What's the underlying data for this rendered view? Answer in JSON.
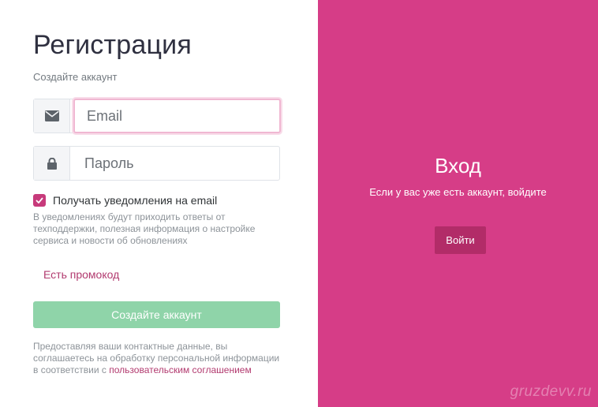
{
  "register": {
    "title": "Регистрация",
    "subtitle": "Создайте аккаунт",
    "email_placeholder": "Email",
    "password_placeholder": "Пароль",
    "notify_label": "Получать уведомления на email",
    "notify_checked": true,
    "notify_hint": "В уведомлениях будут приходить ответы от техподдержки, полезная информация о настройке сервиса и новости об обновлениях",
    "promo_link": "Есть промокод",
    "create_button": "Создайте аккаунт",
    "legal_text": "Предоставляя ваши контактные данные, вы соглашаетесь на обработку персональной информации в соответствии с",
    "legal_link": "пользовательским соглашением"
  },
  "login": {
    "title": "Вход",
    "text": "Если у вас уже есть аккаунт, войдите",
    "button": "Войти"
  },
  "watermark": "gruzdevv.ru",
  "colors": {
    "accent": "#d63d87",
    "button_dark": "#b22c68",
    "create_button": "#8fd4a9",
    "link": "#b23a6f"
  },
  "icons": {
    "email": "envelope-icon",
    "password": "lock-icon",
    "check": "checkmark-icon"
  }
}
